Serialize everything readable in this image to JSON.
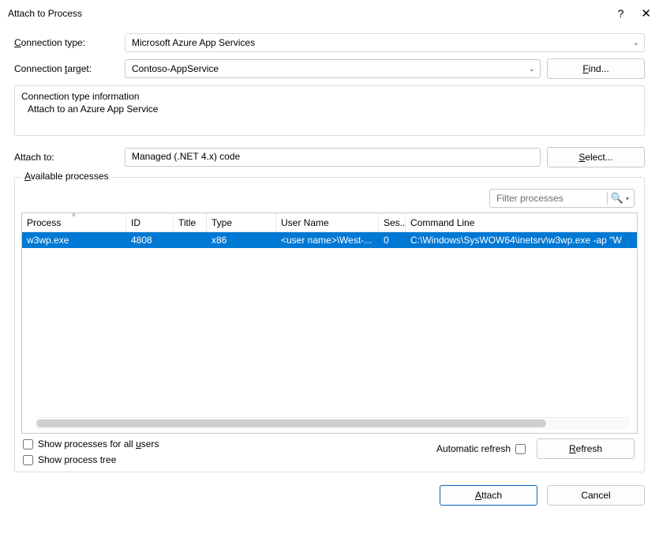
{
  "title": "Attach to Process",
  "help_symbol": "?",
  "close_symbol": "✕",
  "labels": {
    "connection_type": "Connection type:",
    "connection_target": "Connection target:",
    "attach_to": "Attach to:",
    "available_processes": "Available processes",
    "automatic_refresh": "Automatic refresh"
  },
  "buttons": {
    "find": "Find...",
    "select": "Select...",
    "refresh": "Refresh",
    "attach": "Attach",
    "cancel": "Cancel"
  },
  "combos": {
    "connection_type_value": "Microsoft Azure App Services",
    "connection_target_value": "Contoso-AppService"
  },
  "info": {
    "heading": "Connection type information",
    "line": "Attach to an Azure App Service"
  },
  "attach_to_value": "Managed (.NET 4.x) code",
  "filter_placeholder": "Filter processes",
  "columns": {
    "process": "Process",
    "id": "ID",
    "title": "Title",
    "type": "Type",
    "user": "User Name",
    "session": "Ses...",
    "cmd": "Command Line"
  },
  "rows": [
    {
      "process": "w3wp.exe",
      "id": "4808",
      "title": "",
      "type": "x86",
      "user": "<user name>\\West-...",
      "session": "0",
      "cmd": "C:\\Windows\\SysWOW64\\inetsrv\\w3wp.exe -ap \"W",
      "selected": true
    }
  ],
  "checks": {
    "all_users": "Show processes for all users",
    "tree": "Show process tree"
  }
}
